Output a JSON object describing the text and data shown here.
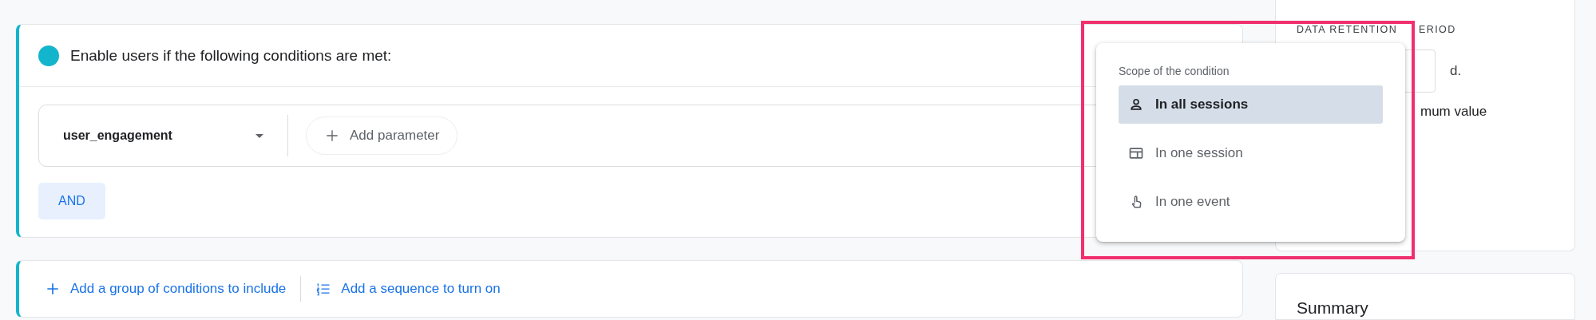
{
  "condition_group": {
    "title": "Enable users if the following conditions are met:",
    "event": "user_engagement",
    "add_parameter": "Add parameter",
    "operator": "AND"
  },
  "actions": [
    {
      "kind": "plus",
      "label": "Add a group of conditions to include"
    },
    {
      "kind": "list",
      "label": "Add a sequence to turn on"
    }
  ],
  "side_panel": {
    "section_title": "DATA RETENTION",
    "section_title_rest": "ERIOD",
    "unit": "d.",
    "option_label": "mum value"
  },
  "summary": {
    "title": "Summary"
  },
  "scope_menu": {
    "title": "Scope of the condition",
    "items": [
      {
        "kind": "person",
        "label": "In all sessions",
        "selected": true
      },
      {
        "kind": "session",
        "label": "In one session",
        "selected": false
      },
      {
        "kind": "touch",
        "label": "In one event",
        "selected": false
      }
    ]
  }
}
